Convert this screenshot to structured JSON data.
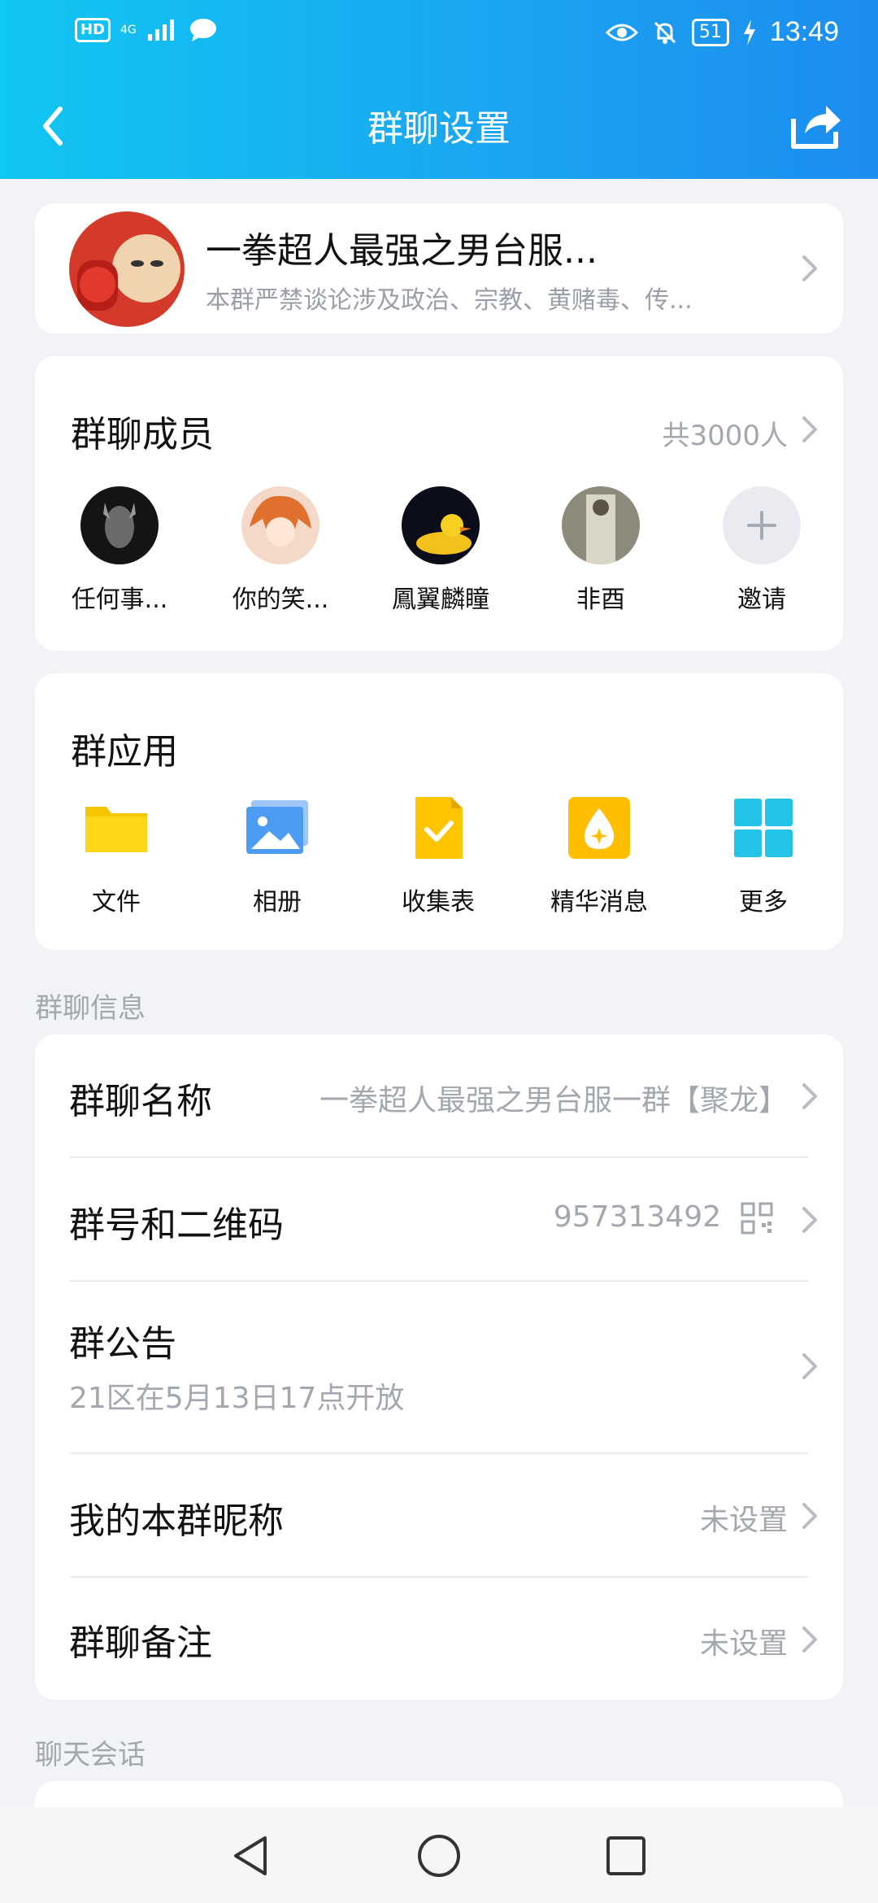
{
  "status": {
    "hd": "HD",
    "network": "4G",
    "battery": "51",
    "time": "13:49"
  },
  "header": {
    "title": "群聊设置"
  },
  "group": {
    "name": "一拳超人最强之男台服...",
    "desc": "本群严禁谈论涉及政治、宗教、黄赌毒、传..."
  },
  "members": {
    "title": "群聊成员",
    "count": "共3000人",
    "list": [
      {
        "name": "任何事..."
      },
      {
        "name": "你的笑..."
      },
      {
        "name": "鳳翼麟瞳"
      },
      {
        "name": "非酉"
      }
    ],
    "invite": "邀请"
  },
  "apps": {
    "title": "群应用",
    "items": [
      {
        "label": "文件",
        "icon": "folder-icon"
      },
      {
        "label": "相册",
        "icon": "album-icon"
      },
      {
        "label": "收集表",
        "icon": "form-icon"
      },
      {
        "label": "精华消息",
        "icon": "essence-icon"
      },
      {
        "label": "更多",
        "icon": "grid-icon"
      }
    ]
  },
  "info": {
    "caption": "群聊信息",
    "rows": {
      "name_label": "群聊名称",
      "name_value": "一拳超人最强之男台服一群【聚龙】",
      "id_label": "群号和二维码",
      "id_value": "957313492",
      "notice_label": "群公告",
      "notice_value": "21区在5月13日17点开放",
      "nick_label": "我的本群昵称",
      "nick_value": "未设置",
      "remark_label": "群聊备注",
      "remark_value": "未设置"
    }
  },
  "chat": {
    "caption": "聊天会话"
  },
  "colors": {
    "header_start": "#10c6f3",
    "header_end": "#1d8df0",
    "background": "#f2f3f7"
  }
}
